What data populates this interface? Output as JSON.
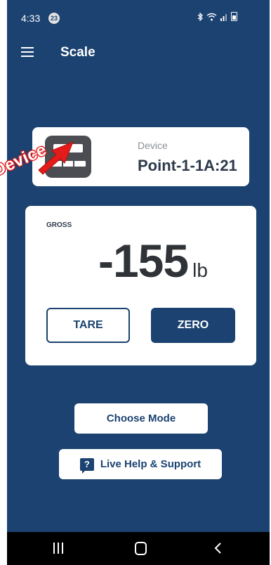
{
  "status_bar": {
    "time": "4:33",
    "notification_count": "23",
    "icons": [
      "bluetooth-icon",
      "wifi-icon",
      "signal-icon",
      "battery-icon"
    ]
  },
  "app_bar": {
    "title": "Scale",
    "menu_icon": "hamburger-menu-icon"
  },
  "device_card": {
    "label": "Device",
    "name": "Point-1-1A:21",
    "icon": "scale-device-icon"
  },
  "annotation": {
    "text": "Device",
    "color": "#e31b1b"
  },
  "gross_card": {
    "label": "GROSS",
    "value": "-155",
    "unit": "lb",
    "tare_label": "TARE",
    "zero_label": "ZERO"
  },
  "actions": {
    "choose_mode_label": "Choose Mode",
    "help_label": "Live Help & Support",
    "help_icon_glyph": "?"
  },
  "nav_bar": {
    "icons": [
      "recents-icon",
      "home-icon",
      "back-icon"
    ]
  },
  "colors": {
    "primary": "#1b4270",
    "card": "#ffffff",
    "annotation": "#e31b1b"
  }
}
